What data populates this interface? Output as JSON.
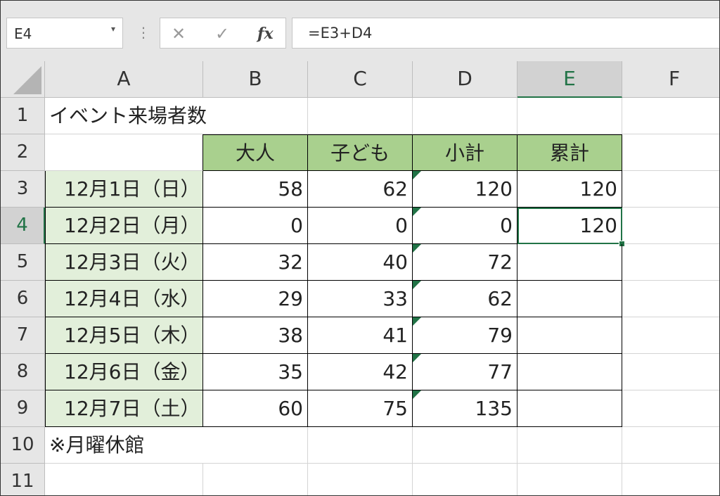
{
  "name_box": "E4",
  "formula": "=E3+D4",
  "fx_label": "fx",
  "columns": [
    "A",
    "B",
    "C",
    "D",
    "E",
    "F"
  ],
  "rows": [
    "1",
    "2",
    "3",
    "4",
    "5",
    "6",
    "7",
    "8",
    "9",
    "10",
    "11"
  ],
  "sheet": {
    "title": "イベント来場者数",
    "headers": [
      "大人",
      "子ども",
      "小計",
      "累計"
    ],
    "records": [
      {
        "date": "12月1日（日）",
        "adult": "58",
        "child": "62",
        "subtotal": "120",
        "cumulative": "120"
      },
      {
        "date": "12月2日（月）",
        "adult": "0",
        "child": "0",
        "subtotal": "0",
        "cumulative": "120"
      },
      {
        "date": "12月3日（火）",
        "adult": "32",
        "child": "40",
        "subtotal": "72",
        "cumulative": ""
      },
      {
        "date": "12月4日（水）",
        "adult": "29",
        "child": "33",
        "subtotal": "62",
        "cumulative": ""
      },
      {
        "date": "12月5日（木）",
        "adult": "38",
        "child": "41",
        "subtotal": "79",
        "cumulative": ""
      },
      {
        "date": "12月6日（金）",
        "adult": "35",
        "child": "42",
        "subtotal": "77",
        "cumulative": ""
      },
      {
        "date": "12月7日（土）",
        "adult": "60",
        "child": "75",
        "subtotal": "135",
        "cumulative": ""
      }
    ],
    "note": "※月曜休館"
  },
  "active_cell": {
    "column": "E",
    "row": "4"
  },
  "colors": {
    "header_fill": "#a9d08e",
    "date_fill": "#e2efda",
    "accent": "#217346"
  }
}
